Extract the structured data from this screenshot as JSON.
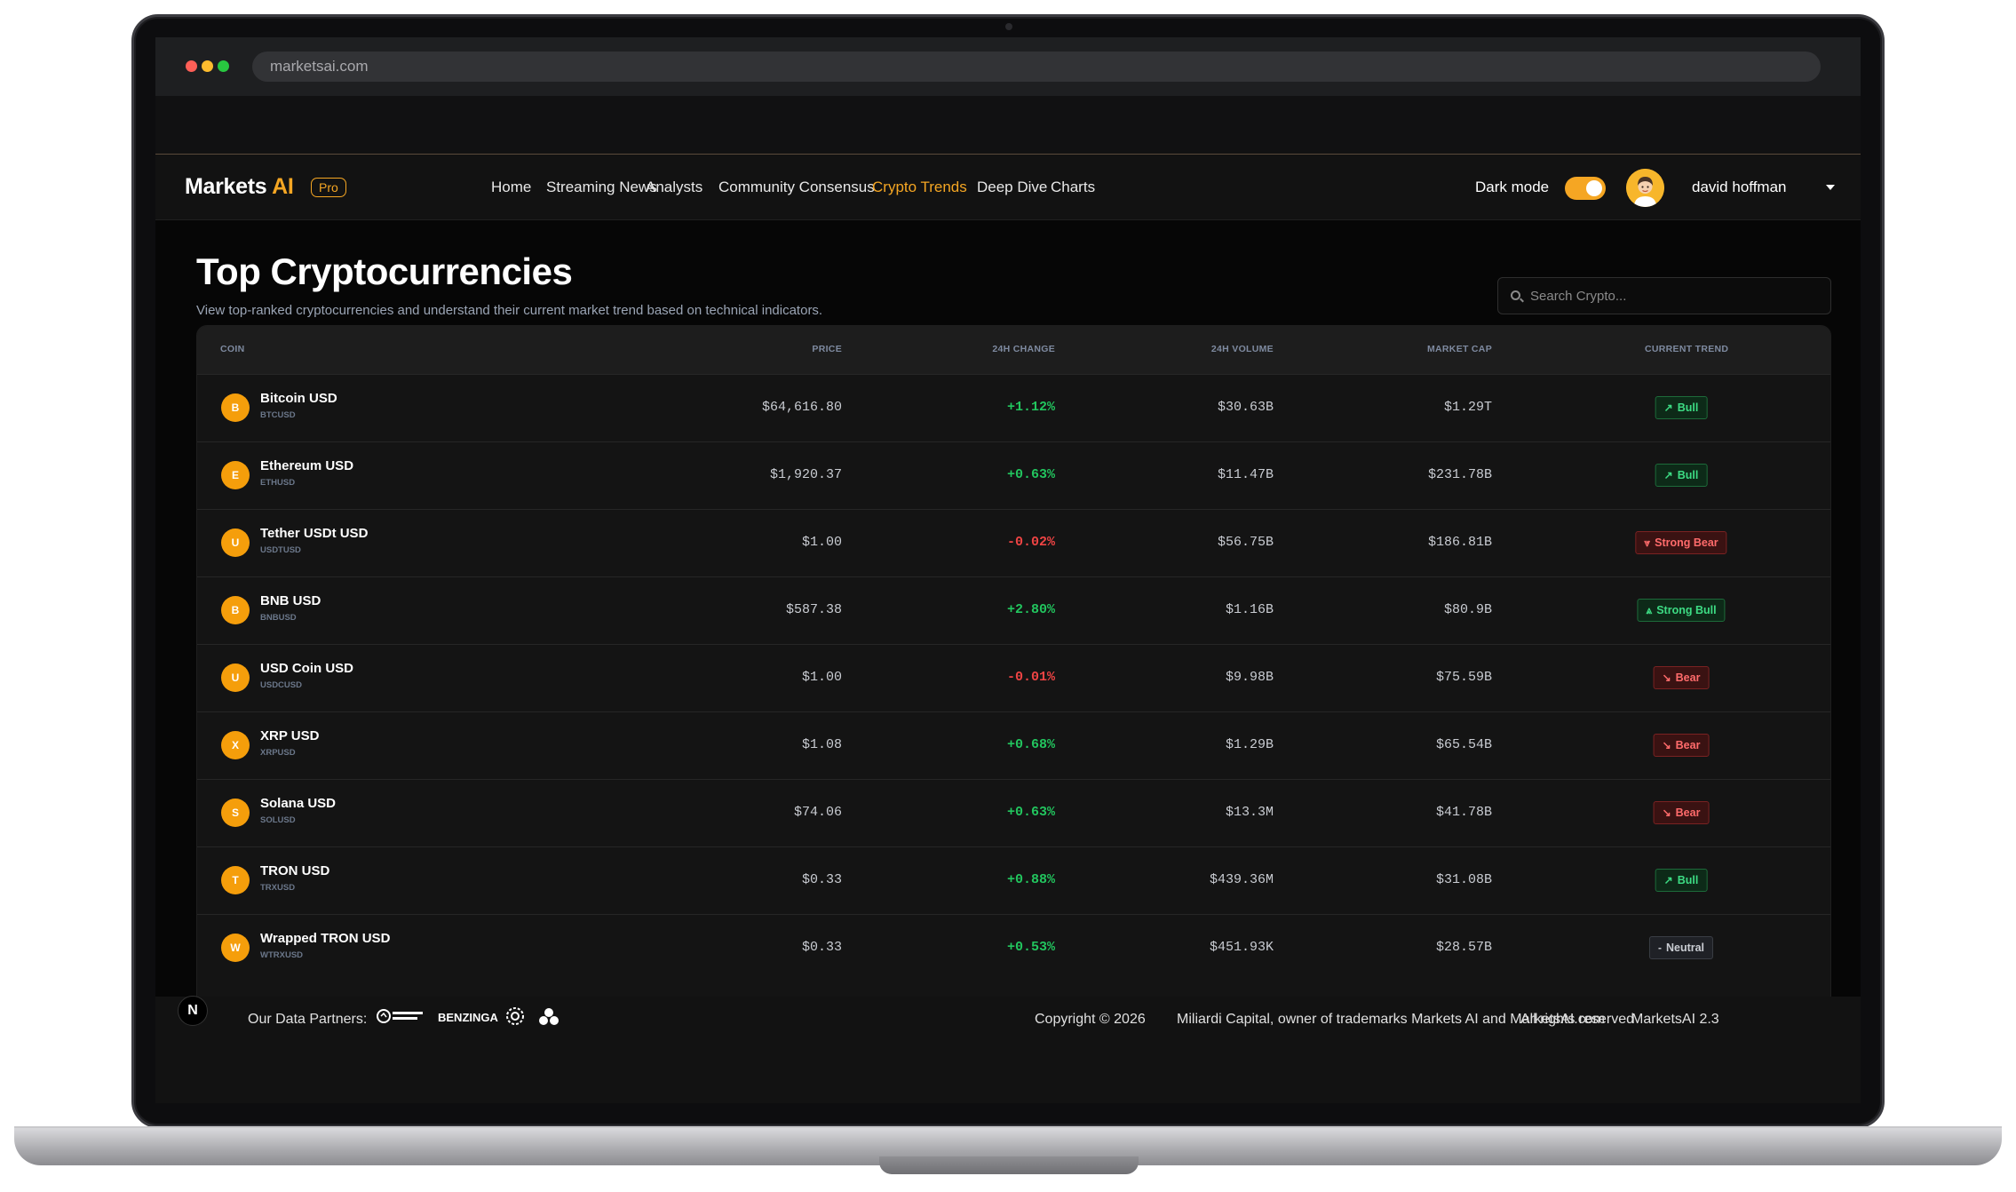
{
  "browser": {
    "url": "marketsai.com"
  },
  "navbar": {
    "brand_main": "Markets",
    "brand_accent": "AI",
    "badge": "Pro",
    "items": [
      {
        "label": "Home",
        "active": false
      },
      {
        "label": "Streaming News",
        "active": false
      },
      {
        "label": "Analysts",
        "active": false
      },
      {
        "label": "Community Consensus",
        "active": false
      },
      {
        "label": "Crypto Trends",
        "active": true
      },
      {
        "label": "Deep Dive",
        "active": false
      },
      {
        "label": "Charts",
        "active": false
      }
    ],
    "dark_mode_label": "Dark mode",
    "dark_mode_on": true,
    "user_name": "david hoffman"
  },
  "page": {
    "title": "Top Cryptocurrencies",
    "subtitle": "View top-ranked cryptocurrencies and understand their current market trend based on technical indicators.",
    "search_placeholder": "Search Crypto..."
  },
  "table": {
    "headers": {
      "coin": "COIN",
      "price": "PRICE",
      "change": "24H CHANGE",
      "volume": "24H VOLUME",
      "market_cap": "MARKET CAP",
      "trend": "CURRENT TREND"
    },
    "rows": [
      {
        "initial": "B",
        "name": "Bitcoin USD",
        "symbol": "BTCUSD",
        "price": "$64,616.80",
        "change": "+1.12%",
        "change_dir": "pos",
        "volume": "$30.63B",
        "market_cap": "$1.29T",
        "trend": "Bull",
        "trend_type": "bull",
        "trend_icon": "↗"
      },
      {
        "initial": "E",
        "name": "Ethereum USD",
        "symbol": "ETHUSD",
        "price": "$1,920.37",
        "change": "+0.63%",
        "change_dir": "pos",
        "volume": "$11.47B",
        "market_cap": "$231.78B",
        "trend": "Bull",
        "trend_type": "bull",
        "trend_icon": "↗"
      },
      {
        "initial": "U",
        "name": "Tether USDt USD",
        "symbol": "USDTUSD",
        "price": "$1.00",
        "change": "-0.02%",
        "change_dir": "neg",
        "volume": "$56.75B",
        "market_cap": "$186.81B",
        "trend": "Strong Bear",
        "trend_type": "bear",
        "trend_icon": "⩔"
      },
      {
        "initial": "B",
        "name": "BNB USD",
        "symbol": "BNBUSD",
        "price": "$587.38",
        "change": "+2.80%",
        "change_dir": "pos",
        "volume": "$1.16B",
        "market_cap": "$80.9B",
        "trend": "Strong Bull",
        "trend_type": "bull",
        "trend_icon": "⩓"
      },
      {
        "initial": "U",
        "name": "USD Coin USD",
        "symbol": "USDCUSD",
        "price": "$1.00",
        "change": "-0.01%",
        "change_dir": "neg",
        "volume": "$9.98B",
        "market_cap": "$75.59B",
        "trend": "Bear",
        "trend_type": "bear",
        "trend_icon": "↘"
      },
      {
        "initial": "X",
        "name": "XRP USD",
        "symbol": "XRPUSD",
        "price": "$1.08",
        "change": "+0.68%",
        "change_dir": "pos",
        "volume": "$1.29B",
        "market_cap": "$65.54B",
        "trend": "Bear",
        "trend_type": "bear",
        "trend_icon": "↘"
      },
      {
        "initial": "S",
        "name": "Solana USD",
        "symbol": "SOLUSD",
        "price": "$74.06",
        "change": "+0.63%",
        "change_dir": "pos",
        "volume": "$13.3M",
        "market_cap": "$41.78B",
        "trend": "Bear",
        "trend_type": "bear",
        "trend_icon": "↘"
      },
      {
        "initial": "T",
        "name": "TRON USD",
        "symbol": "TRXUSD",
        "price": "$0.33",
        "change": "+0.88%",
        "change_dir": "pos",
        "volume": "$439.36M",
        "market_cap": "$31.08B",
        "trend": "Bull",
        "trend_type": "bull",
        "trend_icon": "↗"
      },
      {
        "initial": "W",
        "name": "Wrapped TRON USD",
        "symbol": "WTRXUSD",
        "price": "$0.33",
        "change": "+0.53%",
        "change_dir": "pos",
        "volume": "$451.93K",
        "market_cap": "$28.57B",
        "trend": "Neutral",
        "trend_type": "neutral",
        "trend_icon": "-"
      }
    ]
  },
  "footer": {
    "n_badge": "N",
    "partners_label": "Our Data Partners:",
    "partner_benzinga": "BENZINGA",
    "copyright": "Copyright © 2026",
    "owner": "Miliardi Capital, owner of trademarks Markets AI and MarketsAI.com",
    "rights": "All rights reserved",
    "version": "MarketsAI 2.3"
  },
  "colors": {
    "accent": "#f5a623",
    "positive": "#22c55e",
    "negative": "#ef4444",
    "coin_badge": "#f59e0b"
  }
}
